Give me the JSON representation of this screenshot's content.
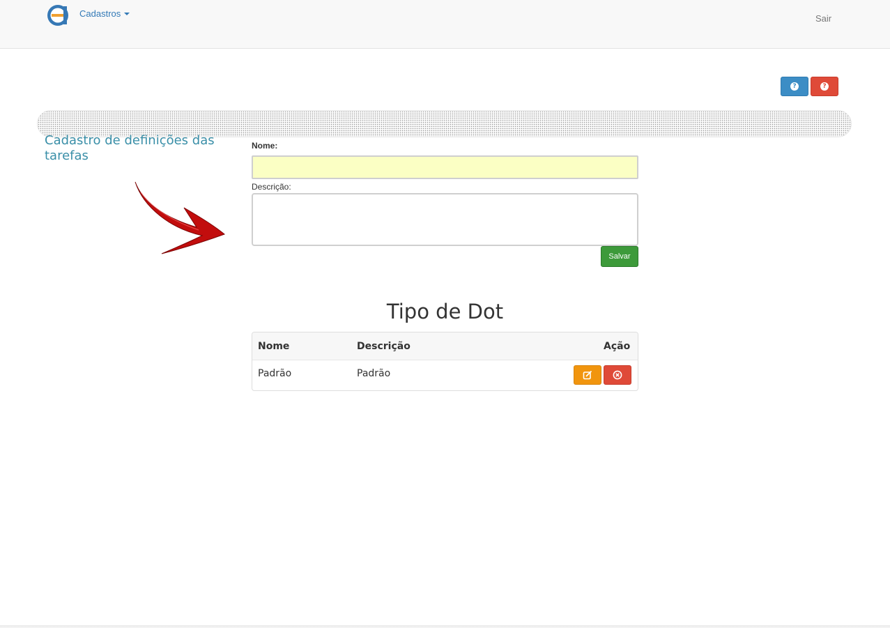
{
  "navbar": {
    "menu_label": "Cadastros",
    "logout_label": "Sair"
  },
  "help_buttons": {
    "help_icon": "question-circle-icon",
    "info_icon": "question-circle-icon"
  },
  "page": {
    "title": "Cadastro de definições das tarefas"
  },
  "form": {
    "name_label": "Nome:",
    "name_value": "",
    "description_label": "Descrição:",
    "description_value": "",
    "save_label": "Salvar"
  },
  "table": {
    "title": "Tipo de Dot",
    "columns": [
      "Nome",
      "Descrição",
      "Ação"
    ],
    "rows": [
      {
        "nome": "Padrão",
        "descricao": "Padrão"
      }
    ]
  },
  "colors": {
    "primary": "#3c8dc5",
    "danger": "#df4a38",
    "success": "#3d9a3a",
    "warning": "#f1950e",
    "title_teal": "#3a8fa8",
    "input_highlight": "#fbffc4"
  }
}
